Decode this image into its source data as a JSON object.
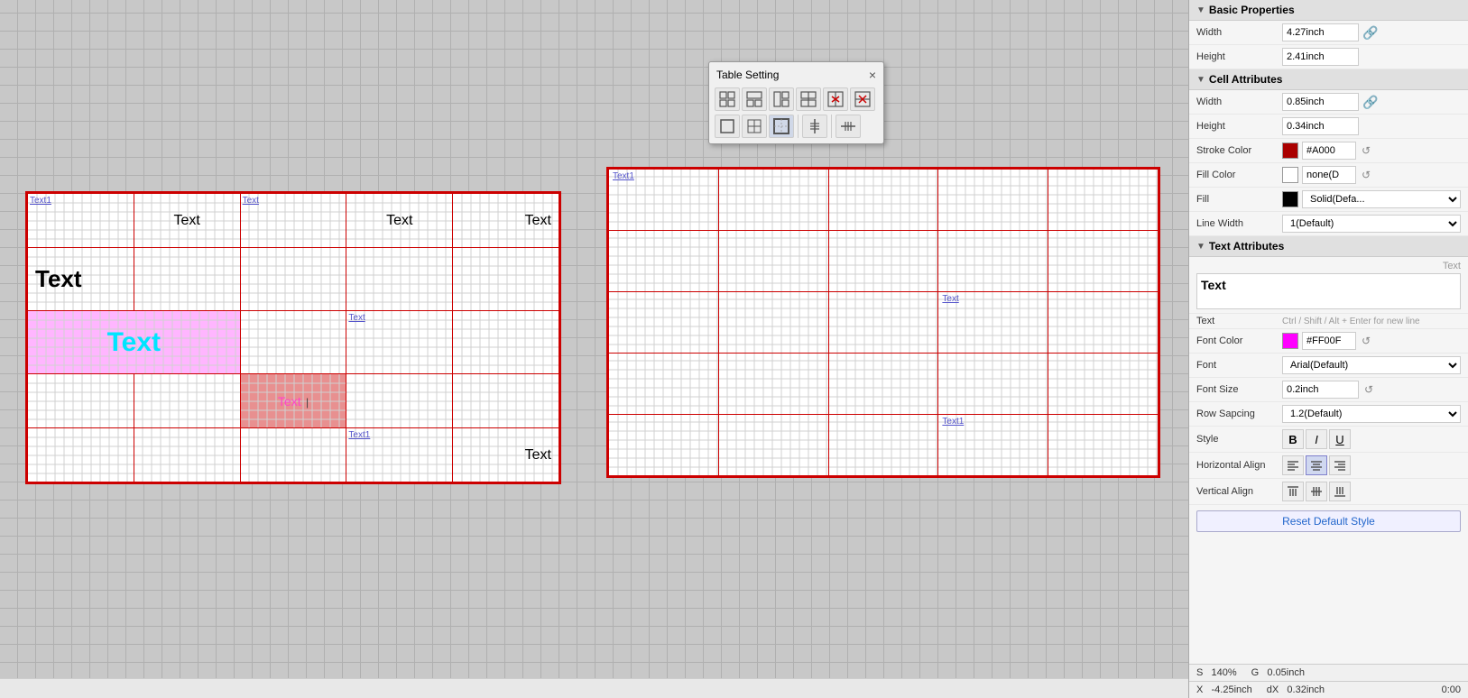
{
  "canvas": {
    "background_color": "#c8c8c8"
  },
  "table_setting": {
    "title": "Table Setting",
    "close_label": "×",
    "buttons": [
      {
        "icon": "⊞",
        "label": "insert-table"
      },
      {
        "icon": "⊟",
        "label": "merge-cells"
      },
      {
        "icon": "⊠",
        "label": "split-cols"
      },
      {
        "icon": "⊡",
        "label": "split-rows"
      },
      {
        "icon": "⊟",
        "label": "delete-col"
      },
      {
        "icon": "⊞",
        "label": "delete-row"
      },
      {
        "icon": "⊞",
        "label": "border-style"
      },
      {
        "icon": "⊟",
        "label": "align-h"
      },
      {
        "icon": "⊡",
        "label": "align-v"
      }
    ]
  },
  "left_table": {
    "cells": [
      [
        {
          "text": "Text1",
          "type": "label",
          "col": 0,
          "row": 0
        },
        {
          "text": "Text",
          "type": "normal-lg",
          "col": 1,
          "row": 0
        },
        {
          "text": "Text",
          "type": "top-label",
          "col": 2,
          "row": 0
        },
        {
          "text": "Text",
          "type": "normal-lg",
          "col": 3,
          "row": 0
        },
        {
          "text": "Text",
          "type": "normal-lg",
          "col": 4,
          "row": 0
        }
      ],
      [
        {
          "text": "Text",
          "type": "bold-large",
          "col": 0,
          "row": 1
        },
        {
          "text": "",
          "col": 1,
          "row": 1
        },
        {
          "text": "",
          "col": 2,
          "row": 1
        },
        {
          "text": "",
          "col": 3,
          "row": 1
        },
        {
          "text": "",
          "col": 4,
          "row": 1
        }
      ],
      [
        {
          "text": "Text",
          "type": "pink-bg-cyan",
          "col": 0,
          "row": 2,
          "colspan": 2
        },
        {
          "text": "",
          "col": 2,
          "row": 2
        },
        {
          "text": "Text",
          "type": "small-label",
          "col": 3,
          "row": 2
        },
        {
          "text": "",
          "col": 4,
          "row": 2
        }
      ],
      [
        {
          "text": "",
          "col": 0,
          "row": 3
        },
        {
          "text": "",
          "col": 1,
          "row": 3
        },
        {
          "text": "Text",
          "type": "highlighted-pink",
          "col": 2,
          "row": 3
        },
        {
          "text": "",
          "col": 3,
          "row": 3
        },
        {
          "text": "",
          "col": 4,
          "row": 3
        }
      ],
      [
        {
          "text": "",
          "col": 0,
          "row": 4
        },
        {
          "text": "",
          "col": 1,
          "row": 4
        },
        {
          "text": "",
          "col": 2,
          "row": 4
        },
        {
          "text": "Text1",
          "type": "small-label",
          "col": 3,
          "row": 4
        },
        {
          "text": "Text",
          "type": "normal-lg",
          "col": 4,
          "row": 4
        }
      ]
    ]
  },
  "right_table": {
    "rows": 5,
    "cols": 5,
    "special_cells": [
      {
        "row": 0,
        "col": 0,
        "text": "Text1",
        "type": "label"
      },
      {
        "row": 2,
        "col": 3,
        "text": "Text",
        "type": "label"
      },
      {
        "row": 4,
        "col": 3,
        "text": "Text1",
        "type": "label"
      }
    ]
  },
  "right_panel": {
    "basic_properties": {
      "title": "Basic Properties",
      "width_label": "Width",
      "width_value": "4.27inch",
      "height_label": "Height",
      "height_value": "2.41inch"
    },
    "cell_attributes": {
      "title": "Cell Attributes",
      "width_label": "Width",
      "width_value": "0.85inch",
      "height_label": "Height",
      "height_value": "0.34inch",
      "stroke_color_label": "Stroke Color",
      "stroke_color_value": "#A000",
      "stroke_color_hex": "#aa0000",
      "fill_color_label": "Fill Color",
      "fill_color_value": "none(D",
      "fill_label": "Fill",
      "fill_value": "Solid(Defa...",
      "fill_color_hex": "#000000",
      "line_width_label": "Line Width",
      "line_width_value": "1(Default)"
    },
    "text_attributes": {
      "title": "Text Attributes",
      "preview_label": "Text",
      "preview_text": "Text",
      "edit_label": "Text",
      "edit_hint": "Ctrl / Shift / Alt + Enter for new line",
      "font_color_label": "Font Color",
      "font_color_value": "#FF00F",
      "font_color_hex": "#ff00ff",
      "font_label": "Font",
      "font_value": "Arial(Default)",
      "font_size_label": "Font Size",
      "font_size_value": "0.2inch",
      "row_spacing_label": "Row Sapcing",
      "row_spacing_value": "1.2(Default)",
      "style_label": "Style",
      "style_bold": "B",
      "style_italic": "I",
      "style_underline": "U",
      "h_align_label": "Horizontal Align",
      "v_align_label": "Vertical Align",
      "reset_label": "Reset Default Style"
    },
    "status": {
      "scale_label": "S",
      "scale_value": "140%",
      "g_label": "G",
      "g_value": "0.05inch",
      "x_label": "X",
      "x_value": "-4.25inch",
      "dx_label": "dX",
      "dx_value": "0.32inch",
      "time": "0:00"
    }
  }
}
